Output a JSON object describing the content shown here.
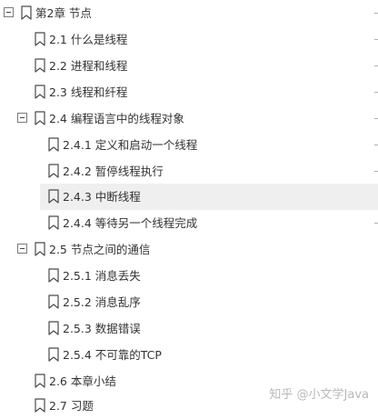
{
  "tree": {
    "items": [
      {
        "label": "第2章 节点",
        "expanded": true
      },
      {
        "label": "2.1 什么是线程"
      },
      {
        "label": "2.2 进程和线程"
      },
      {
        "label": "2.3 线程和纤程"
      },
      {
        "label": "2.4 编程语言中的线程对象",
        "expanded": true
      },
      {
        "label": "2.4.1 定义和启动一个线程"
      },
      {
        "label": "2.4.2 暂停线程执行"
      },
      {
        "label": "2.4.3 中断线程",
        "selected": true
      },
      {
        "label": "2.4.4 等待另一个线程完成"
      },
      {
        "label": "2.5 节点之间的通信",
        "expanded": true
      },
      {
        "label": "2.5.1 消息丢失"
      },
      {
        "label": "2.5.2 消息乱序"
      },
      {
        "label": "2.5.3 数据错误"
      },
      {
        "label": "2.5.4 不可靠的TCP"
      },
      {
        "label": "2.6 本章小结"
      },
      {
        "label": "2.7 习题"
      }
    ]
  },
  "watermark": {
    "text": "知乎 @小文学Java"
  },
  "icons": {
    "toggle": "collapse-minus-icon",
    "entry": "bookmark-icon"
  }
}
